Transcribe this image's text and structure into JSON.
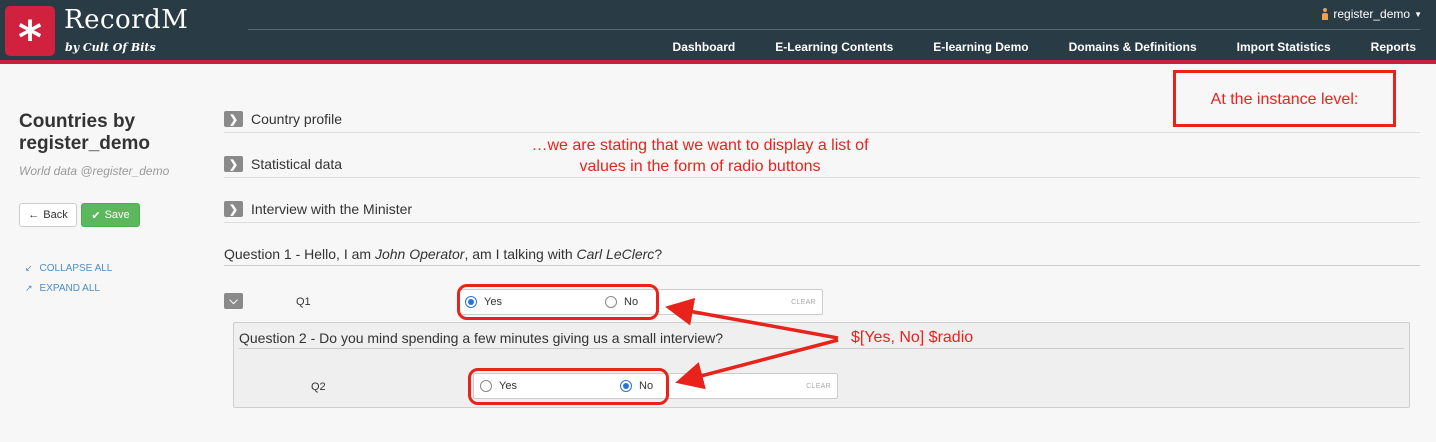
{
  "header": {
    "brand": "RecordM",
    "brand_sub": "by Cult Of Bits",
    "user": "register_demo",
    "nav": [
      "Dashboard",
      "E-Learning Contents",
      "E-learning Demo",
      "Domains & Definitions",
      "Import Statistics",
      "Reports"
    ]
  },
  "left": {
    "title_line1": "Countries by",
    "title_line2": "register_demo",
    "subtitle": "World data @register_demo",
    "back_label": "Back",
    "save_label": "Save",
    "collapse_all": "COLLAPSE ALL",
    "expand_all": "EXPAND ALL"
  },
  "sections": {
    "country_profile": "Country profile",
    "statistical_data": "Statistical data",
    "interview": "Interview with the Minister"
  },
  "question1": {
    "prefix": "Question 1 - Hello, I am ",
    "operator": "John Operator",
    "middle": ", am I talking with ",
    "contact": "Carl LeClerc",
    "suffix": "?",
    "field_label": "Q1",
    "options": [
      "Yes",
      "No"
    ],
    "selected": "Yes",
    "clear_label": "CLEAR"
  },
  "question2": {
    "title": "Question 2 - Do you mind spending a few minutes giving us a small interview?",
    "field_label": "Q2",
    "options": [
      "Yes",
      "No"
    ],
    "selected": "No",
    "clear_label": "CLEAR"
  },
  "annotations": {
    "instance_level": "At the instance level:",
    "stating_line1": "…we are stating that we want to display a list of",
    "stating_line2": "values in the form of radio buttons",
    "syntax": "$[Yes, No] $radio",
    "color": "#e8231c"
  },
  "colors": {
    "header_bg": "#293b44",
    "accent": "#d0223f",
    "save_green": "#5cb85c",
    "link_blue": "#4a8ec9"
  }
}
